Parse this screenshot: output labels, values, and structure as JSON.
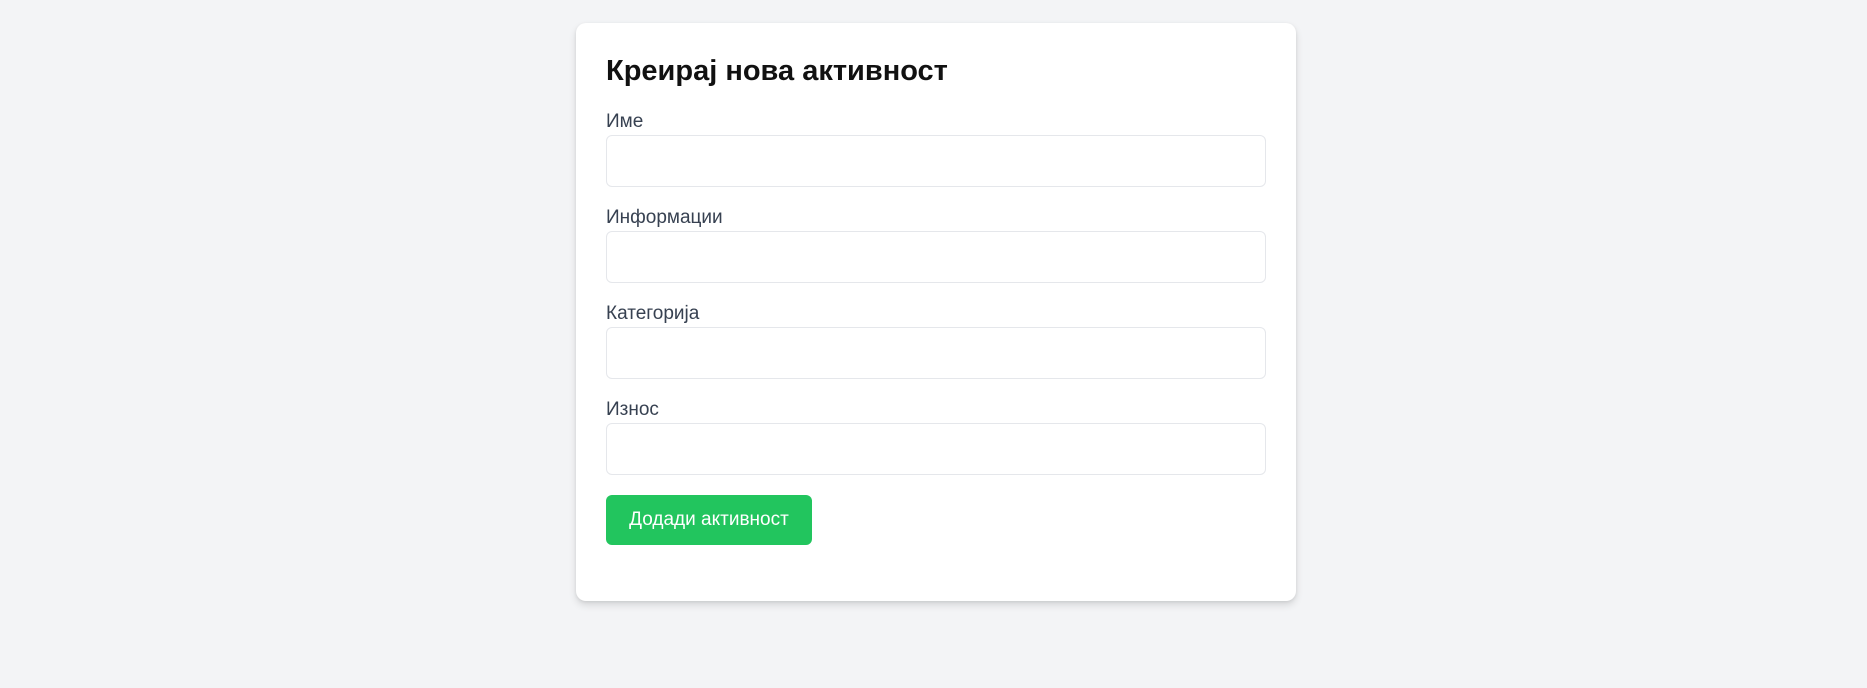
{
  "form": {
    "title": "Креирај нова активност",
    "fields": [
      {
        "label": "Име",
        "value": "",
        "placeholder": ""
      },
      {
        "label": "Информации",
        "value": "",
        "placeholder": ""
      },
      {
        "label": "Категорија",
        "value": "",
        "placeholder": ""
      },
      {
        "label": "Износ",
        "value": "",
        "placeholder": ""
      }
    ],
    "submit_label": "Додади активност"
  },
  "colors": {
    "page_background": "#f3f4f6",
    "card_background": "#ffffff",
    "button_background": "#22c55e",
    "button_text": "#ffffff",
    "label_text": "#374151",
    "title_text": "#111111",
    "input_border": "#e5e7eb"
  }
}
